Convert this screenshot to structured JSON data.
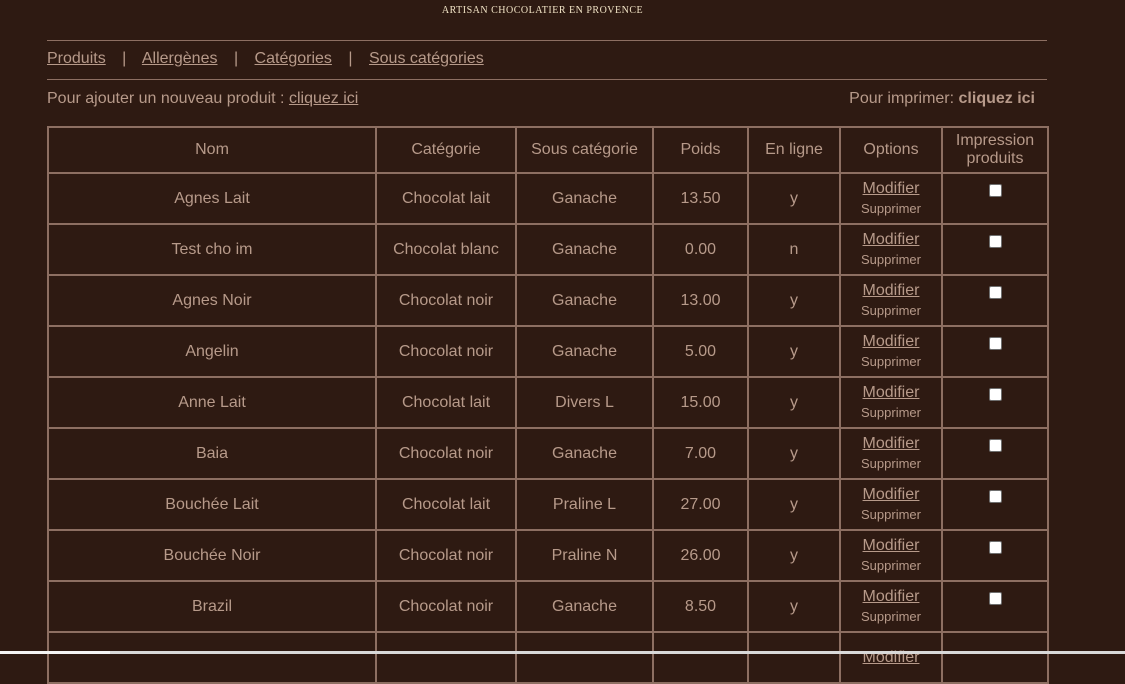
{
  "header": {
    "tagline": "ARTISAN CHOCOLATIER EN PROVENCE"
  },
  "nav": {
    "items": [
      "Produits",
      "Allergènes",
      "Catégories",
      "Sous catégories"
    ],
    "separator": "|"
  },
  "actions": {
    "add_prefix": "Pour ajouter un nouveau produit : ",
    "add_link": "cliquez ici",
    "print_prefix": "Pour imprimer: ",
    "print_link": "cliquez ici"
  },
  "table": {
    "headers": {
      "nom": "Nom",
      "categorie": "Catégorie",
      "sous_categorie": "Sous catégorie",
      "poids": "Poids",
      "en_ligne": "En ligne",
      "options": "Options",
      "impression_line1": "Impression",
      "impression_line2": "produits"
    },
    "option_labels": {
      "modify": "Modifier",
      "delete": "Supprimer"
    },
    "rows": [
      {
        "nom": "Agnes Lait",
        "categorie": "Chocolat lait",
        "sous_categorie": "Ganache",
        "poids": "13.50",
        "en_ligne": "y",
        "checked": false
      },
      {
        "nom": "Test cho im",
        "categorie": "Chocolat blanc",
        "sous_categorie": "Ganache",
        "poids": "0.00",
        "en_ligne": "n",
        "checked": false
      },
      {
        "nom": "Agnes Noir",
        "categorie": "Chocolat noir",
        "sous_categorie": "Ganache",
        "poids": "13.00",
        "en_ligne": "y",
        "checked": false
      },
      {
        "nom": "Angelin",
        "categorie": "Chocolat noir",
        "sous_categorie": "Ganache",
        "poids": "5.00",
        "en_ligne": "y",
        "checked": false
      },
      {
        "nom": "Anne Lait",
        "categorie": "Chocolat lait",
        "sous_categorie": "Divers L",
        "poids": "15.00",
        "en_ligne": "y",
        "checked": false
      },
      {
        "nom": "Baia",
        "categorie": "Chocolat noir",
        "sous_categorie": "Ganache",
        "poids": "7.00",
        "en_ligne": "y",
        "checked": false
      },
      {
        "nom": "Bouchée Lait",
        "categorie": "Chocolat lait",
        "sous_categorie": "Praline L",
        "poids": "27.00",
        "en_ligne": "y",
        "checked": false
      },
      {
        "nom": "Bouchée Noir",
        "categorie": "Chocolat noir",
        "sous_categorie": "Praline N",
        "poids": "26.00",
        "en_ligne": "y",
        "checked": false
      },
      {
        "nom": "Brazil",
        "categorie": "Chocolat noir",
        "sous_categorie": "Ganache",
        "poids": "8.50",
        "en_ligne": "y",
        "checked": false
      }
    ]
  },
  "colors": {
    "background": "#2e1a12",
    "text": "#b79a8a",
    "border": "#8d6f62",
    "tagline": "#f1e3c5"
  }
}
